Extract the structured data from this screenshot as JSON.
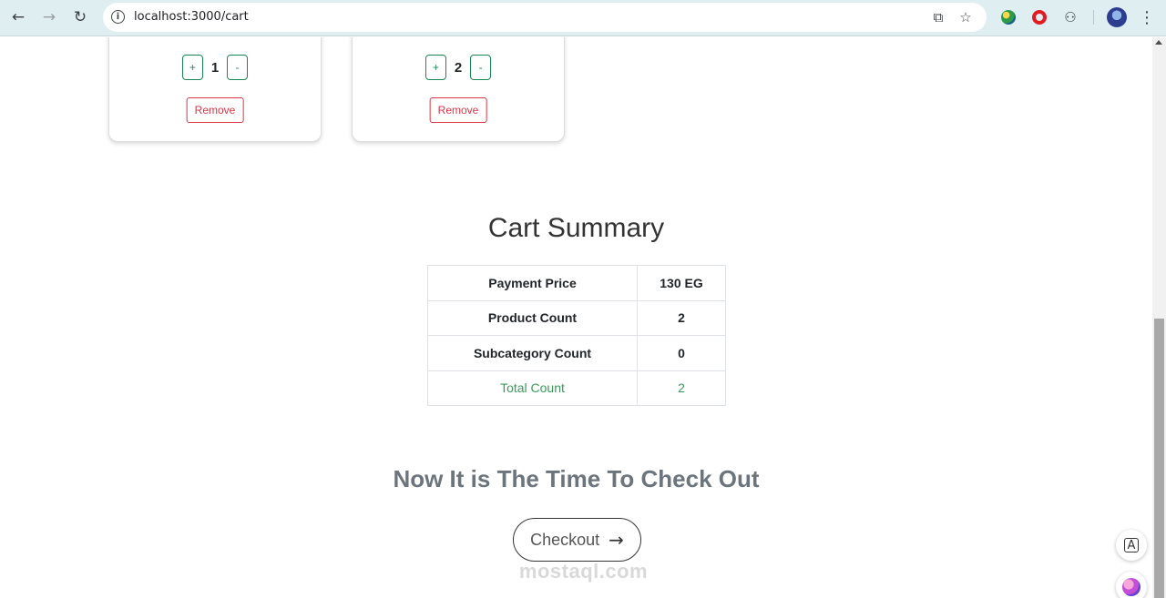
{
  "browser": {
    "url": "localhost:3000/cart",
    "icons": {
      "back": "arrow-left-icon",
      "forward": "arrow-right-icon",
      "reload": "reload-icon",
      "site_info": "info-icon",
      "install": "install-app-icon",
      "bookmark": "star-icon",
      "extensions": "puzzle-icon",
      "menu": "kebab-menu-icon"
    }
  },
  "cart_items": [
    {
      "quantity": "1",
      "plus_label": "+",
      "minus_label": "-",
      "remove_label": "Remove"
    },
    {
      "quantity": "2",
      "plus_label": "+",
      "minus_label": "-",
      "remove_label": "Remove"
    }
  ],
  "summary": {
    "title": "Cart Summary",
    "rows": [
      {
        "label": "Payment Price",
        "value": "130 EG"
      },
      {
        "label": "Product Count",
        "value": "2"
      },
      {
        "label": "Subcategory Count",
        "value": "0"
      },
      {
        "label": "Total Count",
        "value": "2"
      }
    ]
  },
  "checkout": {
    "heading": "Now It is The Time To Check Out",
    "button_label": "Checkout"
  },
  "watermark": "mostaql.com",
  "colors": {
    "success": "#198754",
    "danger": "#dc3545",
    "total_text": "#3a9a5b",
    "chrome_bg": "#dfeef1"
  }
}
